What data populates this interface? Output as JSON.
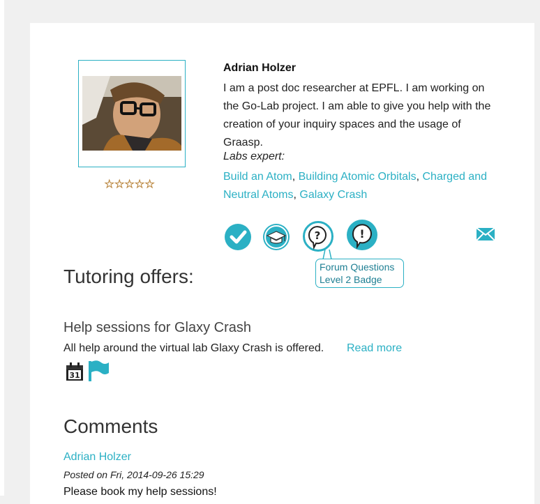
{
  "profile": {
    "name": "Adrian Holzer",
    "bio": "I am a post doc researcher at EPFL. I am working on the Go-Lab project. I am able to give you help with the creation of your inquiry spaces and the usage of Graasp.",
    "rating_stars": 5,
    "labs_expert_label": "Labs expert:",
    "labs": [
      "Build an Atom",
      "Building Atomic Orbitals",
      "Charged and Neutral Atoms",
      "Galaxy Crash"
    ],
    "labs_separator": ", "
  },
  "badges": [
    {
      "icon": "checkmark-icon"
    },
    {
      "icon": "graduation-cap-icon"
    },
    {
      "icon": "question-bubble-icon"
    },
    {
      "icon": "exclamation-bubble-icon"
    }
  ],
  "tooltip": {
    "line1": "Forum Questions",
    "line2": "Level 2 Badge"
  },
  "tutoring": {
    "heading": "Tutoring offers:",
    "offer_title": "Help sessions for Glaxy Crash",
    "offer_description": "All help around the virtual lab Glaxy Crash is offered.",
    "read_more": "Read more",
    "calendar_day": "31"
  },
  "comments": {
    "heading": "Comments",
    "items": [
      {
        "author": "Adrian Holzer",
        "posted_prefix": "Posted on ",
        "posted_date": "Fri, 2014-09-26 15:29",
        "body": "Please book my help sessions!"
      }
    ]
  },
  "colors": {
    "accent": "#2bb0c4",
    "star": "#e2a53a"
  }
}
